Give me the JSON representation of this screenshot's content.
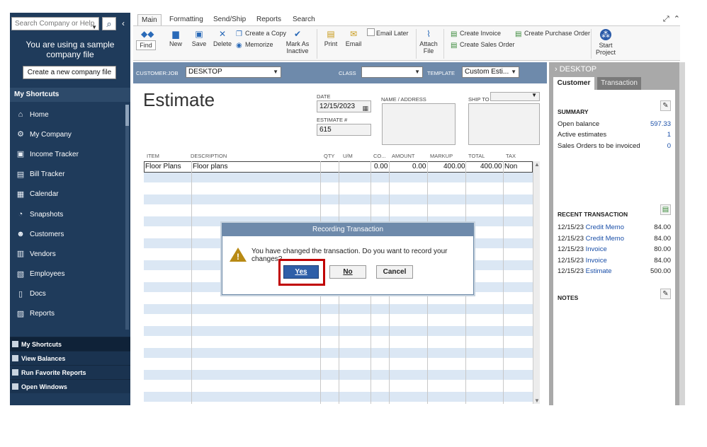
{
  "sidebar": {
    "search_placeholder": "Search Company or Help",
    "search_button": "⌕",
    "collapse": "‹",
    "sample_message": "You are using a sample company file",
    "create_company": "Create a new company file",
    "shortcuts_header": "My Shortcuts",
    "items": [
      {
        "label": "Home",
        "icon": "house-icon"
      },
      {
        "label": "My Company",
        "icon": "company-icon"
      },
      {
        "label": "Income Tracker",
        "icon": "income-tracker-icon"
      },
      {
        "label": "Bill Tracker",
        "icon": "bill-tracker-icon"
      },
      {
        "label": "Calendar",
        "icon": "calendar-icon"
      },
      {
        "label": "Snapshots",
        "icon": "pie-chart-icon"
      },
      {
        "label": "Customers",
        "icon": "customer-icon"
      },
      {
        "label": "Vendors",
        "icon": "vendor-icon"
      },
      {
        "label": "Employees",
        "icon": "employee-icon"
      },
      {
        "label": "Docs",
        "icon": "document-icon"
      },
      {
        "label": "Reports",
        "icon": "report-icon"
      }
    ],
    "bottom": [
      "My Shortcuts",
      "View Balances",
      "Run Favorite Reports",
      "Open Windows"
    ]
  },
  "ribbon": {
    "tabs": [
      "Main",
      "Formatting",
      "Send/Ship",
      "Reports",
      "Search"
    ],
    "active_tab": "Main",
    "find": "Find",
    "new": "New",
    "save": "Save",
    "delete": "Delete",
    "create_copy": "Create a Copy",
    "memorize": "Memorize",
    "mark_as_inactive": "Mark As Inactive",
    "print": "Print",
    "email": "Email",
    "email_later": "Email Later",
    "attach_file": "Attach File",
    "create_invoice": "Create Invoice",
    "create_sales_order": "Create Sales Order",
    "create_purchase_order": "Create Purchase Order",
    "start_project": "Start Project"
  },
  "customer_bar": {
    "customer_job_label": "CUSTOMER:JOB",
    "customer_job_value": "DESKTOP",
    "class_label": "CLASS",
    "class_value": "",
    "template_label": "TEMPLATE",
    "template_value": "Custom Esti..."
  },
  "form": {
    "title": "Estimate",
    "date_label": "DATE",
    "date_value": "12/15/2023",
    "estimate_no_label": "ESTIMATE #",
    "estimate_no_value": "615",
    "name_address_label": "NAME / ADDRESS",
    "ship_to_label": "SHIP TO",
    "columns": [
      "ITEM",
      "DESCRIPTION",
      "QTY",
      "U/M",
      "CO...",
      "AMOUNT",
      "MARKUP",
      "TOTAL",
      "TAX"
    ],
    "rows": [
      {
        "item": "Floor Plans",
        "description": "Floor plans",
        "qty": "",
        "um": "",
        "cost": "0.00",
        "amount": "0.00",
        "markup": "400.00",
        "total": "400.00",
        "tax": "Non"
      }
    ]
  },
  "right_panel": {
    "title": "DESKTOP",
    "tab_customer": "Customer",
    "tab_transaction": "Transaction",
    "summary_header": "SUMMARY",
    "summary": [
      {
        "label": "Open balance",
        "value": "597.33"
      },
      {
        "label": "Active estimates",
        "value": "1"
      },
      {
        "label": "Sales Orders to be invoiced",
        "value": "0"
      }
    ],
    "recent_header": "RECENT TRANSACTION",
    "recent": [
      {
        "date": "12/15/23",
        "type": "Credit Memo",
        "amount": "84.00"
      },
      {
        "date": "12/15/23",
        "type": "Credit Memo",
        "amount": "84.00"
      },
      {
        "date": "12/15/23",
        "type": "Invoice",
        "amount": "80.00"
      },
      {
        "date": "12/15/23",
        "type": "Invoice",
        "amount": "84.00"
      },
      {
        "date": "12/15/23",
        "type": "Estimate",
        "amount": "500.00"
      }
    ],
    "notes_header": "NOTES"
  },
  "dialog": {
    "title": "Recording Transaction",
    "message": "You have changed the transaction. Do you want to record your changes?",
    "yes": "Yes",
    "no": "No",
    "cancel": "Cancel"
  },
  "colors": {
    "sidebar_bg": "#1f3b5b",
    "header_bar": "#6e8aab",
    "row_stripe": "#dbe7f4",
    "link": "#1a4fa8",
    "highlight": "#c00000"
  }
}
